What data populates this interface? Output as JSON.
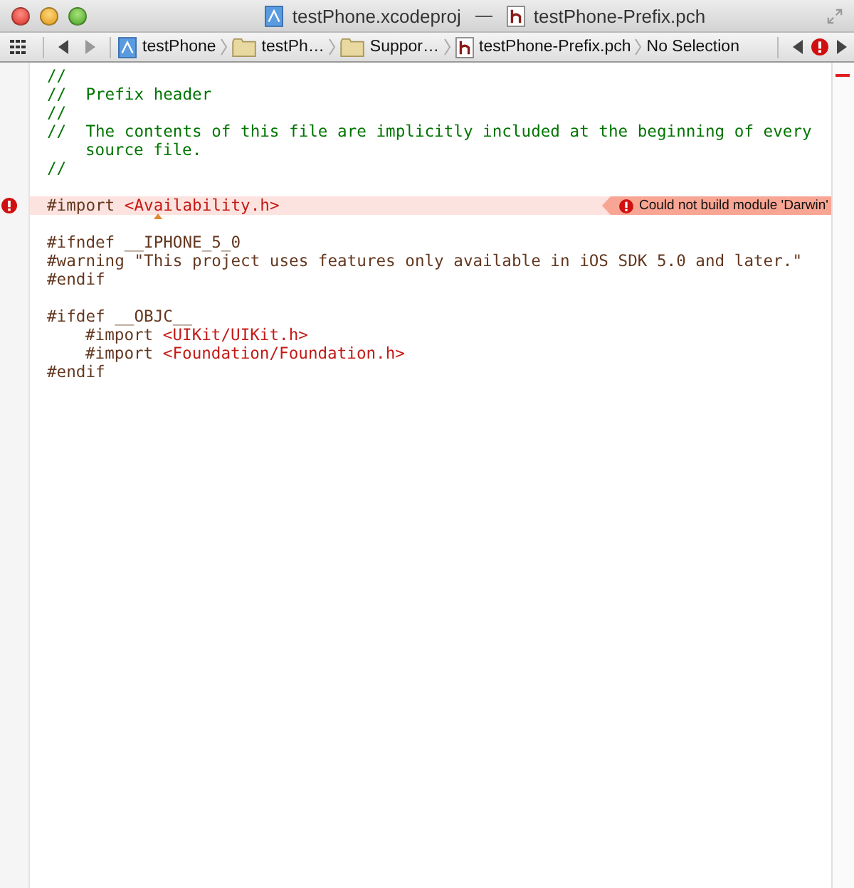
{
  "window": {
    "title_items": [
      {
        "kind": "project",
        "label": "testPhone.xcodeproj"
      },
      {
        "kind": "header",
        "label": "testPhone-Prefix.pch"
      }
    ]
  },
  "jump_bar": [
    {
      "kind": "project",
      "label": "testPhone"
    },
    {
      "kind": "folder",
      "label": "testPh…"
    },
    {
      "kind": "folder",
      "label": "Suppor…"
    },
    {
      "kind": "header",
      "label": "testPhone-Prefix.pch"
    },
    {
      "kind": "symbol",
      "label": "No Selection"
    }
  ],
  "blocks": [
    [
      {
        "indent": false,
        "tokens": [
          {
            "kind": "comment",
            "text": "//"
          }
        ]
      },
      {
        "indent": false,
        "tokens": [
          {
            "kind": "comment",
            "text": "//  Prefix header"
          }
        ]
      },
      {
        "indent": false,
        "tokens": [
          {
            "kind": "comment",
            "text": "//"
          }
        ]
      },
      {
        "indent": false,
        "tokens": [
          {
            "kind": "comment",
            "text": "//  The contents of this file are implicitly included at the beginning of every"
          }
        ]
      },
      {
        "indent": true,
        "tokens": [
          {
            "kind": "comment",
            "text": "source file."
          }
        ]
      },
      {
        "indent": false,
        "tokens": [
          {
            "kind": "comment",
            "text": "//"
          }
        ]
      }
    ],
    [
      {
        "indent": false,
        "error": {
          "message": "Could not build module 'Darwin'"
        },
        "tokens": [
          {
            "kind": "directive",
            "text": "#import "
          },
          {
            "kind": "string",
            "text": "<Availability.h>"
          }
        ]
      }
    ],
    [
      {
        "indent": false,
        "tokens": [
          {
            "kind": "directive",
            "text": "#ifndef __IPHONE_5_0"
          }
        ]
      },
      {
        "indent": false,
        "tokens": [
          {
            "kind": "directive",
            "text": "#warning \"This project uses features only available in iOS SDK 5.0 and later.\""
          }
        ]
      },
      {
        "indent": false,
        "tokens": [
          {
            "kind": "directive",
            "text": "#endif"
          }
        ]
      }
    ],
    [
      {
        "indent": false,
        "tokens": [
          {
            "kind": "directive",
            "text": "#ifdef __OBJC__"
          }
        ]
      },
      {
        "indent": true,
        "tokens": [
          {
            "kind": "directive",
            "text": "#import "
          },
          {
            "kind": "string",
            "text": "<UIKit/UIKit.h>"
          }
        ]
      },
      {
        "indent": true,
        "tokens": [
          {
            "kind": "directive",
            "text": "#import "
          },
          {
            "kind": "string",
            "text": "<Foundation/Foundation.h>"
          }
        ]
      },
      {
        "indent": false,
        "tokens": [
          {
            "kind": "directive",
            "text": "#endif"
          }
        ]
      }
    ]
  ]
}
